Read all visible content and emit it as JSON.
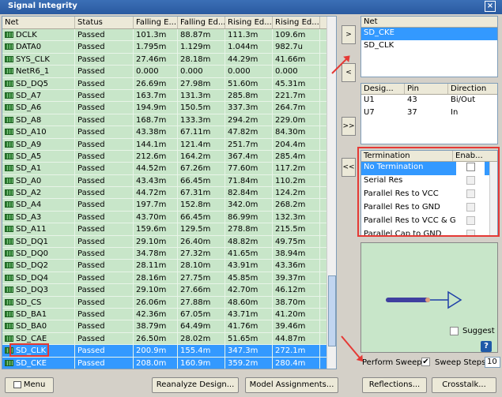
{
  "window": {
    "title": "Signal Integrity",
    "close_glyph": "×"
  },
  "net_table": {
    "columns": [
      "Net",
      "Status",
      "Falling E...",
      "Falling Ed...",
      "Rising Ed...",
      "Rising Ed..."
    ],
    "rows": [
      [
        "DCLK",
        "Passed",
        "101.3m",
        "88.87m",
        "111.3m",
        "109.6m"
      ],
      [
        "DATA0",
        "Passed",
        "1.795m",
        "1.129m",
        "1.044m",
        "982.7u"
      ],
      [
        "SYS_CLK",
        "Passed",
        "27.46m",
        "28.18m",
        "44.29m",
        "41.66m"
      ],
      [
        "NetR6_1",
        "Passed",
        "0.000",
        "0.000",
        "0.000",
        "0.000"
      ],
      [
        "SD_DQ5",
        "Passed",
        "26.69m",
        "27.98m",
        "51.60m",
        "45.31m"
      ],
      [
        "SD_A7",
        "Passed",
        "163.7m",
        "131.3m",
        "285.8m",
        "221.7m"
      ],
      [
        "SD_A6",
        "Passed",
        "194.9m",
        "150.5m",
        "337.3m",
        "264.7m"
      ],
      [
        "SD_A8",
        "Passed",
        "168.7m",
        "133.3m",
        "294.2m",
        "229.0m"
      ],
      [
        "SD_A10",
        "Passed",
        "43.38m",
        "67.11m",
        "47.82m",
        "84.30m"
      ],
      [
        "SD_A9",
        "Passed",
        "144.1m",
        "121.4m",
        "251.7m",
        "204.4m"
      ],
      [
        "SD_A5",
        "Passed",
        "212.6m",
        "164.2m",
        "367.4m",
        "285.4m"
      ],
      [
        "SD_A1",
        "Passed",
        "44.52m",
        "67.26m",
        "77.60m",
        "117.2m"
      ],
      [
        "SD_A0",
        "Passed",
        "43.43m",
        "66.45m",
        "71.84m",
        "110.2m"
      ],
      [
        "SD_A2",
        "Passed",
        "44.72m",
        "67.31m",
        "82.84m",
        "124.2m"
      ],
      [
        "SD_A4",
        "Passed",
        "197.7m",
        "152.8m",
        "342.0m",
        "268.2m"
      ],
      [
        "SD_A3",
        "Passed",
        "43.70m",
        "66.45m",
        "86.99m",
        "132.3m"
      ],
      [
        "SD_A11",
        "Passed",
        "159.6m",
        "129.5m",
        "278.8m",
        "215.5m"
      ],
      [
        "SD_DQ1",
        "Passed",
        "29.10m",
        "26.40m",
        "48.82m",
        "49.75m"
      ],
      [
        "SD_DQ0",
        "Passed",
        "34.78m",
        "27.32m",
        "41.65m",
        "38.94m"
      ],
      [
        "SD_DQ2",
        "Passed",
        "28.11m",
        "28.10m",
        "43.91m",
        "43.36m"
      ],
      [
        "SD_DQ4",
        "Passed",
        "28.16m",
        "27.75m",
        "45.85m",
        "39.37m"
      ],
      [
        "SD_DQ3",
        "Passed",
        "29.10m",
        "27.66m",
        "42.70m",
        "46.12m"
      ],
      [
        "SD_CS",
        "Passed",
        "26.06m",
        "27.88m",
        "48.60m",
        "38.70m"
      ],
      [
        "SD_BA1",
        "Passed",
        "42.36m",
        "67.05m",
        "43.71m",
        "41.20m"
      ],
      [
        "SD_BA0",
        "Passed",
        "38.79m",
        "64.49m",
        "41.76m",
        "39.46m"
      ],
      [
        "SD_CAE",
        "Passed",
        "26.50m",
        "28.02m",
        "51.65m",
        "44.87m"
      ],
      [
        "SD_CLK",
        "Passed",
        "200.9m",
        "155.4m",
        "347.3m",
        "272.1m"
      ],
      [
        "SD_CKE",
        "Passed",
        "208.0m",
        "160.9m",
        "359.2m",
        "280.4m"
      ]
    ]
  },
  "move_buttons": [
    ">",
    "<",
    ">>",
    "<<"
  ],
  "selected_nets": {
    "header": "Net",
    "items": [
      "SD_CKE",
      "SD_CLK"
    ]
  },
  "designators": {
    "columns": [
      "Desig...",
      "Pin",
      "Direction"
    ],
    "rows": [
      [
        "U1",
        "43",
        "Bi/Out"
      ],
      [
        "U7",
        "37",
        "In"
      ]
    ]
  },
  "termination": {
    "columns": [
      "Termination",
      "Enab..."
    ],
    "rows": [
      "No Termination",
      "Serial Res",
      "Parallel Res to VCC",
      "Parallel Res to GND",
      "Parallel Res to VCC & GI",
      "Parallel Cap to GND"
    ],
    "checked_glyph": "✔"
  },
  "suggest_label": "Suggest",
  "help_label": "?",
  "sweep": {
    "label": "Perform Sweep",
    "steps_label": "Sweep Steps:",
    "steps_value": "10",
    "check_glyph": "✔"
  },
  "buttons": {
    "menu": "Menu",
    "reanalyze": "Reanalyze Design...",
    "model": "Model Assignments...",
    "reflections": "Reflections...",
    "crosstalk": "Crosstalk..."
  },
  "accent": {
    "pass_row": "#c8e6c9",
    "selected": "#3399ff",
    "highlight": "#e53935"
  }
}
